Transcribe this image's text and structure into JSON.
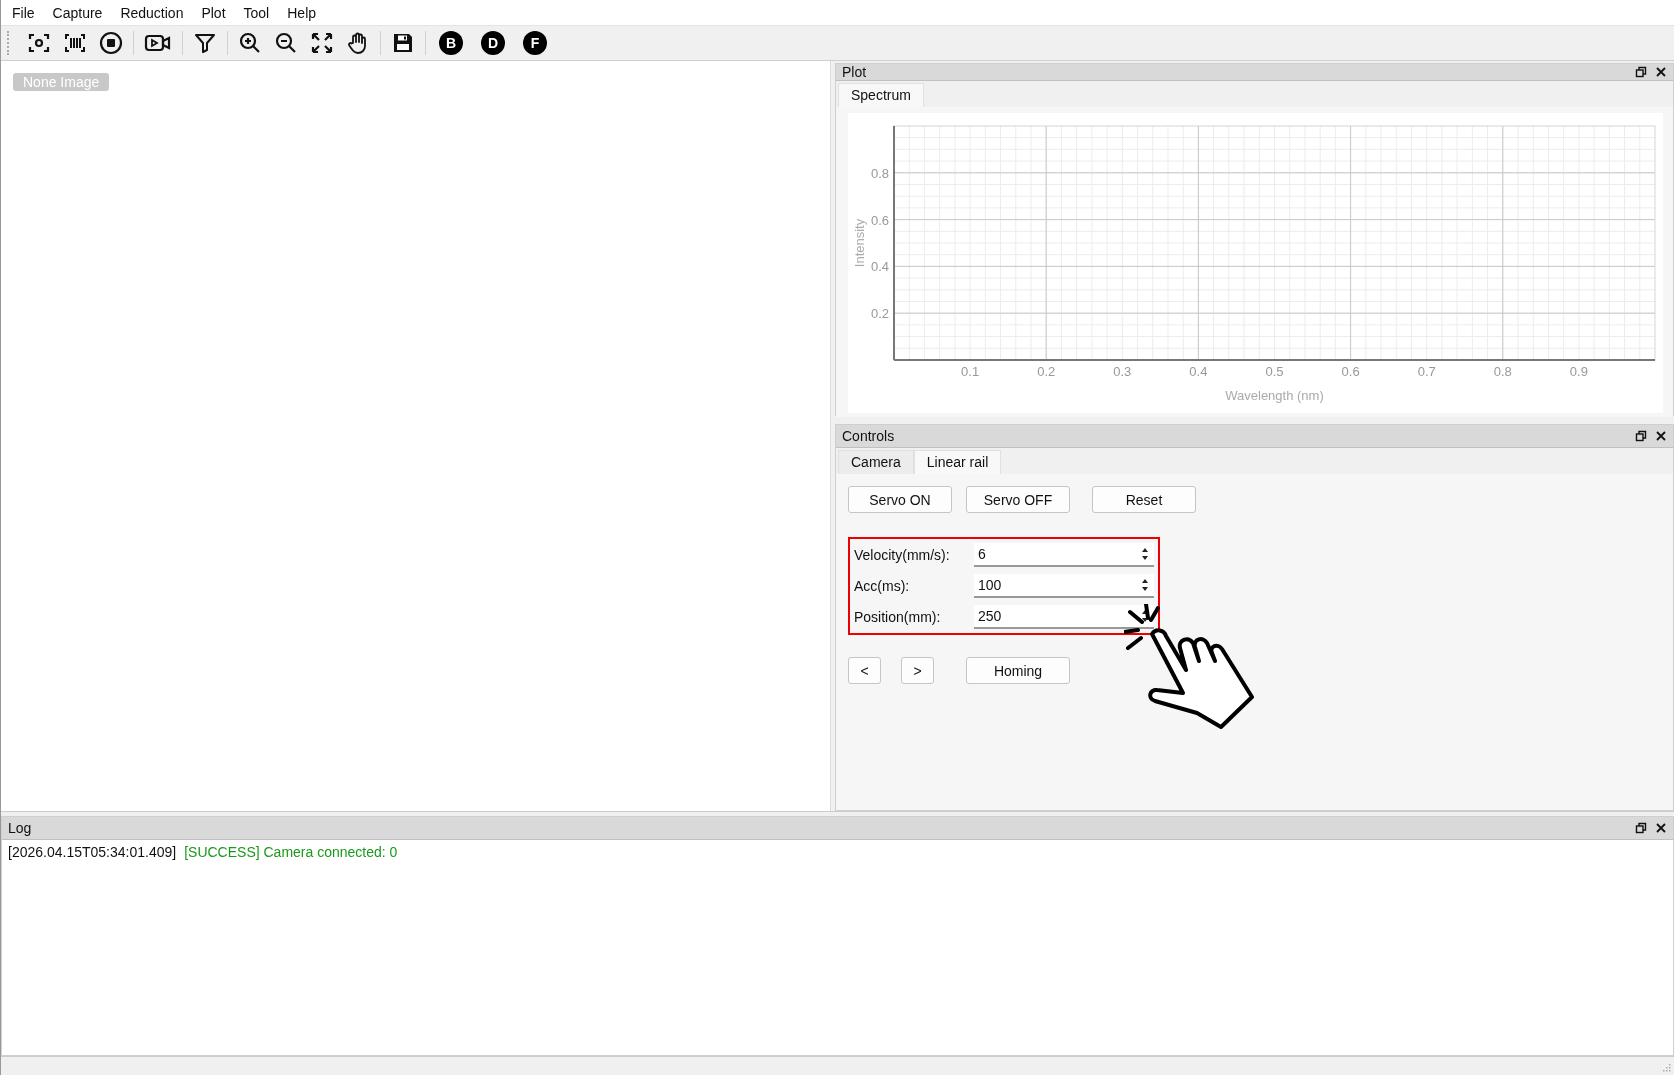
{
  "menu": [
    "File",
    "Capture",
    "Reduction",
    "Plot",
    "Tool",
    "Help"
  ],
  "toolbar": {
    "letter_buttons": [
      "B",
      "D",
      "F"
    ]
  },
  "image_view": {
    "badge": "None Image"
  },
  "plot_dock": {
    "title": "Plot",
    "tabs": [
      {
        "label": "Spectrum",
        "selected": true
      }
    ],
    "chart_data": {
      "type": "line",
      "xlabel": "Wavelength (nm)",
      "ylabel": "Intensity",
      "xlim": [
        0,
        1
      ],
      "ylim": [
        0,
        1
      ],
      "xticks": [
        0.1,
        0.2,
        0.3,
        0.4,
        0.5,
        0.6,
        0.7,
        0.8,
        0.9
      ],
      "yticks": [
        0.2,
        0.4,
        0.6,
        0.8
      ],
      "grid": true
    }
  },
  "controls_dock": {
    "title": "Controls",
    "tabs": [
      {
        "label": "Camera",
        "selected": false
      },
      {
        "label": "Linear rail",
        "selected": true
      }
    ],
    "buttons": [
      "Servo ON",
      "Servo OFF",
      "Reset"
    ],
    "fields": [
      {
        "label": "Velocity(mm/s):",
        "value": "6"
      },
      {
        "label": "Acc(ms):",
        "value": "100"
      },
      {
        "label": "Position(mm):",
        "value": "250"
      }
    ],
    "nav_buttons": [
      "<",
      ">"
    ],
    "homing_button": "Homing"
  },
  "log_dock": {
    "title": "Log",
    "entries": [
      {
        "timestamp": "[2026.04.15T05:34:01.409]",
        "kind": "success",
        "message": "[SUCCESS] Camera connected: 0"
      }
    ]
  }
}
